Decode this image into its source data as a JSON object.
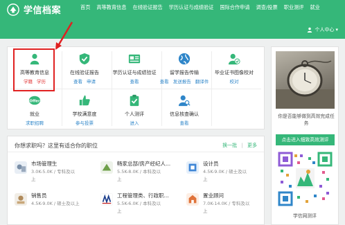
{
  "header": {
    "brand": "学信档案",
    "nav": [
      "首页",
      "高等教育信息",
      "在线验证报告",
      "学历认证与成绩验证",
      "国际合作申请",
      "调查/投票",
      "职业测评",
      "就业"
    ],
    "user_menu": "个人中心"
  },
  "services": [
    {
      "title": "高等教育信息",
      "links": [
        "学籍",
        "学历"
      ],
      "icon": "person-icon"
    },
    {
      "title": "在线验证报告",
      "links": [
        "查看",
        "申请"
      ],
      "icon": "shield-check-icon"
    },
    {
      "title": "学历认证与成绩验证",
      "links": [
        "查看"
      ],
      "icon": "id-card-icon"
    },
    {
      "title": "留学报告传输",
      "links": [
        "查看",
        "发送报告",
        "翻译件"
      ],
      "icon": "globe-icon"
    },
    {
      "title": "毕业证书图像校对",
      "links": [
        "校对"
      ],
      "icon": "user-check-icon"
    },
    {
      "title": "就业",
      "links": [
        "求职招聘"
      ],
      "icon": "offer-icon"
    },
    {
      "title": "学校满意度",
      "links": [
        "参与投票"
      ],
      "icon": "thumbs-up-icon"
    },
    {
      "title": "个人测评",
      "links": [
        "进入"
      ],
      "icon": "clipboard-check-icon"
    },
    {
      "title": "信息核查确认",
      "links": [
        "查看"
      ],
      "icon": "user-search-icon"
    }
  ],
  "jobs": {
    "heading": "你想求职吗？这里有适合你的职位",
    "refresh": "换一批",
    "more": "更多",
    "items": [
      {
        "title": "市场管理生",
        "detail": "3.0K-5.0K / 专科及以",
        "detail2": "上"
      },
      {
        "title": "畅家总部/房产经纪人...",
        "detail": "5.5K-8.0K / 本科及以",
        "detail2": "上"
      },
      {
        "title": "设计员",
        "detail": "4.5K-9.0K / 硕士及以",
        "detail2": "上"
      },
      {
        "title": "销售员",
        "detail": "4.5K-9.0K / 硕士及以上",
        "detail2": ""
      },
      {
        "title": "工程管理类、行政职...",
        "detail": "5.5K-6.0K / 本科及以",
        "detail2": "上"
      },
      {
        "title": "置业顾问",
        "detail": "7.0K-14.0K / 专科及以",
        "detail2": "上"
      }
    ]
  },
  "sidebar": {
    "caption": "你是否能够做到高效完成任务",
    "button": "点击进入细致高效测评",
    "qr_caption": "学信网测评"
  },
  "colors": {
    "brand": "#35b779",
    "link": "#2f86c9",
    "highlight": "#e02020"
  }
}
